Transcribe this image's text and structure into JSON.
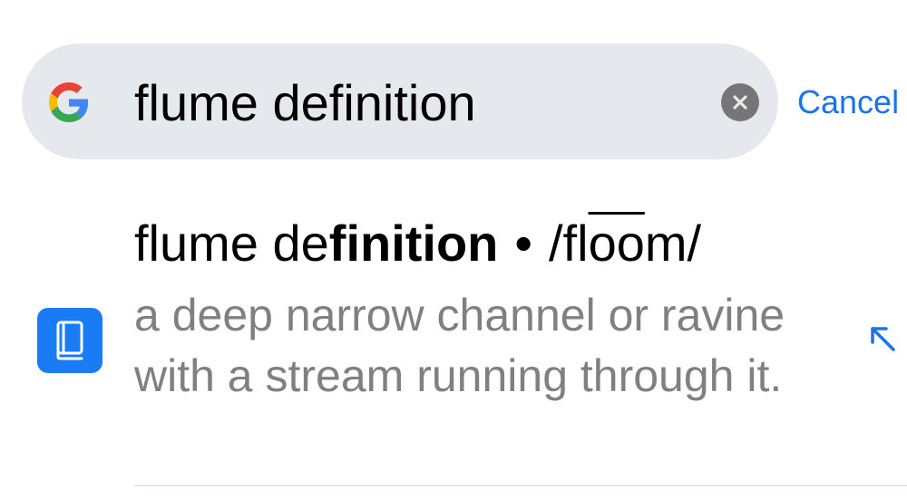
{
  "search": {
    "query": "flume definition",
    "cancel_label": "Cancel"
  },
  "suggestion": {
    "title_prefix": "flume de",
    "title_bold": "finition",
    "separator": "•",
    "pron_start": "/fl",
    "pron_marked": "oo",
    "pron_end": "m/",
    "definition": "a deep narrow channel or ravine with a stream running through it."
  },
  "icons": {
    "search_provider": "google-icon",
    "clear": "clear-icon",
    "suggestion_type": "dictionary-book-icon",
    "fill_query": "arrow-up-left-icon"
  },
  "colors": {
    "accent": "#1a73e8",
    "search_bar_bg": "#e5e8ec",
    "definition_text": "#808080",
    "book_icon_bg": "#1a7cf5"
  }
}
